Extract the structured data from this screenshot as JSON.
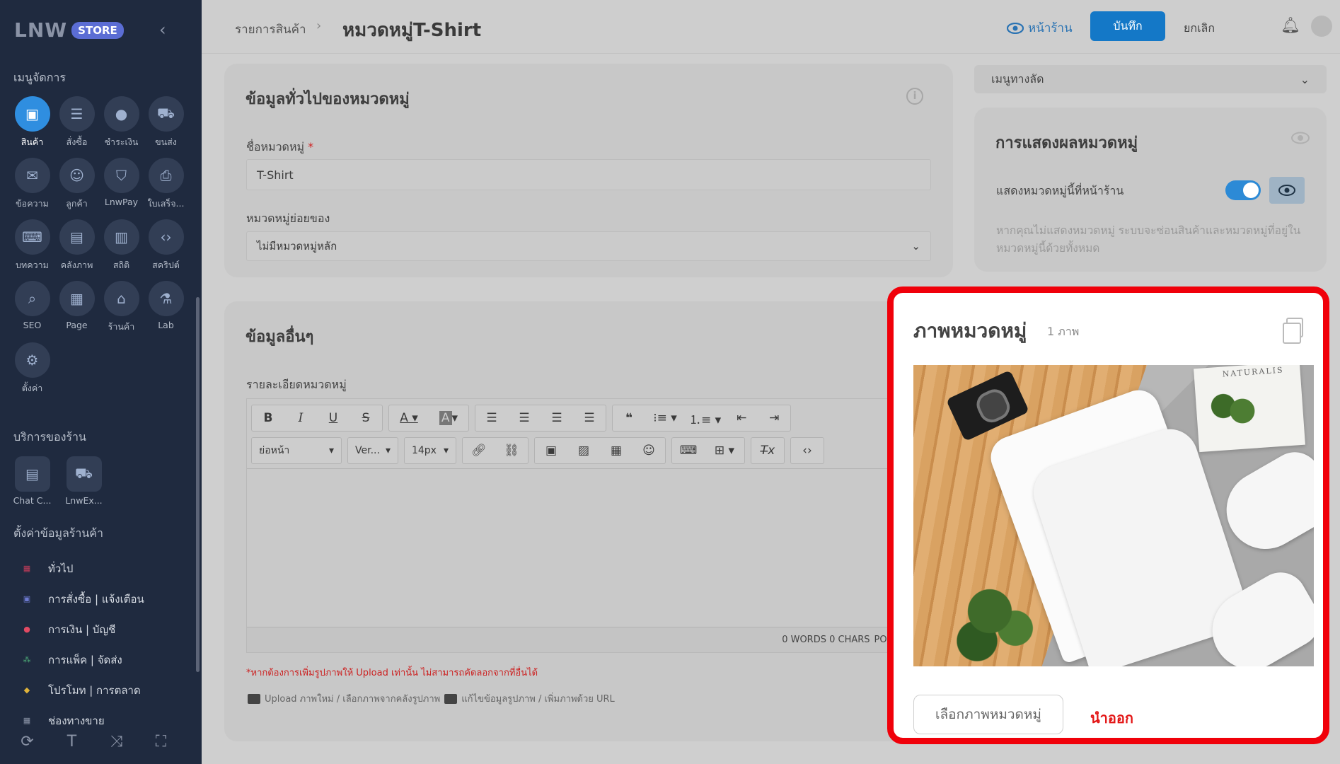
{
  "brand": {
    "logo_text": "LNW",
    "badge": "STORE"
  },
  "sidebar": {
    "manage_title": "เมนูจัดการ",
    "manage_items": [
      {
        "label": "สินค้า",
        "icon": "box-icon"
      },
      {
        "label": "สั่งซื้อ",
        "icon": "clipboard-icon"
      },
      {
        "label": "ชำระเงิน",
        "icon": "piggy-bank-icon"
      },
      {
        "label": "ขนส่ง",
        "icon": "truck-icon"
      },
      {
        "label": "ข้อความ",
        "icon": "mailbox-icon"
      },
      {
        "label": "ลูกค้า",
        "icon": "customer-icon"
      },
      {
        "label": "LnwPay",
        "icon": "shield-icon"
      },
      {
        "label": "ใบเสร็จ...",
        "icon": "receipt-icon"
      },
      {
        "label": "บทความ",
        "icon": "keyboard-icon"
      },
      {
        "label": "คลังภาพ",
        "icon": "gallery-icon"
      },
      {
        "label": "สถิติ",
        "icon": "chart-icon"
      },
      {
        "label": "สคริปต์",
        "icon": "code-icon"
      },
      {
        "label": "SEO",
        "icon": "seo-icon"
      },
      {
        "label": "Page",
        "icon": "page-icon"
      },
      {
        "label": "ร้านค้า",
        "icon": "shop-icon"
      },
      {
        "label": "Lab",
        "icon": "flask-icon"
      },
      {
        "label": "ตั้งค่า",
        "icon": "gear-icon"
      }
    ],
    "services_title": "บริการของร้าน",
    "services": [
      {
        "label": "Chat C...",
        "icon": "chat-icon"
      },
      {
        "label": "LnwEx...",
        "icon": "express-truck-icon"
      }
    ],
    "settings_title": "ตั้งค่าข้อมูลร้านค้า",
    "settings_items": [
      {
        "label": "ทั่วไป",
        "icon": "flag-icon"
      },
      {
        "label": "การสั่งซื้อ | แจ้งเตือน",
        "icon": "order-icon"
      },
      {
        "label": "การเงิน | บัญชี",
        "icon": "money-icon"
      },
      {
        "label": "การแพ็ค | จัดส่ง",
        "icon": "pack-icon"
      },
      {
        "label": "โปรโมท | การตลาด",
        "icon": "promo-icon"
      },
      {
        "label": "ช่องทางขาย",
        "icon": "channel-icon"
      }
    ]
  },
  "header": {
    "breadcrumb": "รายการสินค้า",
    "title": "หมวดหมู่T-Shirt",
    "storefront_link": "หน้าร้าน",
    "save_label": "บันทึก",
    "cancel_label": "ยกเลิก"
  },
  "general": {
    "title": "ข้อมูลทั่วไปของหมวดหมู่",
    "name_label": "ชื่อหมวดหมู่",
    "name_value": "T-Shirt",
    "parent_label": "หมวดหมู่ย่อยของ",
    "parent_value": "ไม่มีหมวดหมู่หลัก"
  },
  "other": {
    "title": "ข้อมูลอื่นๆ",
    "desc_label": "รายละเอียดหมวดหมู่",
    "paragraph_style": "ย่อหน้า",
    "font_name": "Ver...",
    "font_size": "14px",
    "status": "0 WORDS 0 CHARS",
    "powered": "POWERED B",
    "note_red": "*หากต้องการเพิ่มรูปภาพให้ Upload เท่านั้น ไม่สามารถคัดลอกจากที่อื่นได้",
    "note_upload_a": "Upload ภาพใหม่ / เลือกภาพจากคลังรูปภาพ",
    "note_upload_b": "แก้ไขข้อมูลรูปภาพ / เพิ่มภาพด้วย URL"
  },
  "shortcut": {
    "label": "เมนูทางลัด"
  },
  "display": {
    "title": "การแสดงผลหมวดหมู่",
    "toggle_label": "แสดงหมวดหมู่นี้ที่หน้าร้าน",
    "toggle_on": true,
    "hint": "หากคุณไม่แสดงหมวดหมู่ ระบบจะซ่อนสินค้าและหมวดหมู่ที่อยู่ในหมวดหมู่นี้ด้วยทั้งหมด"
  },
  "image_panel": {
    "title": "ภาพหมวดหมู่",
    "count": "1 ภาพ",
    "choose_label": "เลือกภาพหมวดหมู่",
    "remove_label": "นำออก",
    "photo_text": "NATURALIS"
  },
  "colors": {
    "accent": "#1478c7",
    "highlight": "#f0000a",
    "sidebar": "#1f2a3f"
  }
}
